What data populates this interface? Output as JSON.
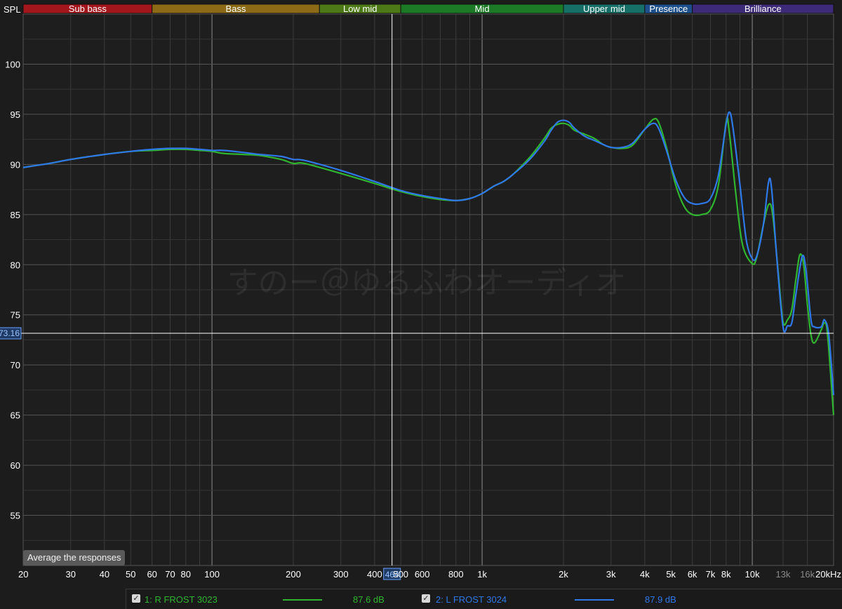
{
  "y_axis_title": "SPL",
  "average_button": {
    "label": "Average the responses"
  },
  "cursor": {
    "x_readout": "464",
    "y_readout": "73.16"
  },
  "watermark": "すのー＠ゆるふわオーディオ",
  "bands": [
    {
      "label": "Sub bass",
      "from": 20,
      "to": 60,
      "color": "#a3161c"
    },
    {
      "label": "Bass",
      "from": 60,
      "to": 250,
      "color": "#8c6a16"
    },
    {
      "label": "Low mid",
      "from": 250,
      "to": 500,
      "color": "#4d7a16"
    },
    {
      "label": "Mid",
      "from": 500,
      "to": 2000,
      "color": "#1c7a27"
    },
    {
      "label": "Upper mid",
      "from": 2000,
      "to": 4000,
      "color": "#177068"
    },
    {
      "label": "Presence",
      "from": 4000,
      "to": 6000,
      "color": "#1c4f8c"
    },
    {
      "label": "Brilliance",
      "from": 6000,
      "to": 20000,
      "color": "#3d2a78"
    }
  ],
  "legend": [
    {
      "checkbox": "✓",
      "name": "1: R FROST 3023",
      "value": "87.6 dB",
      "color": "#2fb52f"
    },
    {
      "checkbox": "✓",
      "name": "2: L FROST 3024",
      "value": "87.9 dB",
      "color": "#2f78e8"
    }
  ],
  "chart_data": {
    "type": "line",
    "xlabel": "",
    "ylabel": "SPL",
    "x_scale": "log",
    "xlim": [
      20,
      20000
    ],
    "ylim": [
      50,
      105
    ],
    "grid": true,
    "x_ticks": [
      {
        "value": 20,
        "label": "20"
      },
      {
        "value": 30,
        "label": "30"
      },
      {
        "value": 40,
        "label": "40"
      },
      {
        "value": 50,
        "label": "50"
      },
      {
        "value": 60,
        "label": "60"
      },
      {
        "value": 70,
        "label": "70"
      },
      {
        "value": 80,
        "label": "80"
      },
      {
        "value": 100,
        "label": "100"
      },
      {
        "value": 200,
        "label": "200"
      },
      {
        "value": 300,
        "label": "300"
      },
      {
        "value": 400,
        "label": "400"
      },
      {
        "value": 500,
        "label": "500"
      },
      {
        "value": 600,
        "label": "600"
      },
      {
        "value": 800,
        "label": "800"
      },
      {
        "value": 1000,
        "label": "1k"
      },
      {
        "value": 2000,
        "label": "2k"
      },
      {
        "value": 3000,
        "label": "3k"
      },
      {
        "value": 4000,
        "label": "4k"
      },
      {
        "value": 5000,
        "label": "5k"
      },
      {
        "value": 6000,
        "label": "6k"
      },
      {
        "value": 7000,
        "label": "7k"
      },
      {
        "value": 8000,
        "label": "8k"
      },
      {
        "value": 10000,
        "label": "10k"
      },
      {
        "value": 13000,
        "label": "13k",
        "dim": true
      },
      {
        "value": 16000,
        "label": "16k",
        "dim": true
      },
      {
        "value": 20000,
        "label": "20kHz"
      }
    ],
    "y_ticks": [
      55,
      60,
      65,
      70,
      75,
      80,
      85,
      90,
      95,
      100
    ],
    "series": [
      {
        "name": "1: R FROST 3023",
        "color": "#2fb52f",
        "points": [
          [
            20,
            89.7
          ],
          [
            25,
            90.1
          ],
          [
            30,
            90.5
          ],
          [
            40,
            91.0
          ],
          [
            50,
            91.3
          ],
          [
            60,
            91.4
          ],
          [
            70,
            91.5
          ],
          [
            80,
            91.5
          ],
          [
            90,
            91.4
          ],
          [
            100,
            91.3
          ],
          [
            110,
            91.1
          ],
          [
            130,
            91.0
          ],
          [
            150,
            90.9
          ],
          [
            180,
            90.5
          ],
          [
            200,
            90.1
          ],
          [
            220,
            90.1
          ],
          [
            300,
            89.1
          ],
          [
            400,
            88.1
          ],
          [
            500,
            87.3
          ],
          [
            600,
            86.8
          ],
          [
            700,
            86.5
          ],
          [
            800,
            86.4
          ],
          [
            900,
            86.6
          ],
          [
            1000,
            87.1
          ],
          [
            1100,
            87.8
          ],
          [
            1200,
            88.3
          ],
          [
            1300,
            89.0
          ],
          [
            1500,
            90.7
          ],
          [
            1700,
            92.6
          ],
          [
            1800,
            93.6
          ],
          [
            1900,
            94.0
          ],
          [
            2000,
            94.1
          ],
          [
            2100,
            93.9
          ],
          [
            2200,
            93.4
          ],
          [
            2400,
            93.0
          ],
          [
            2600,
            92.6
          ],
          [
            2800,
            92.0
          ],
          [
            3000,
            91.7
          ],
          [
            3300,
            91.6
          ],
          [
            3600,
            91.9
          ],
          [
            4000,
            93.5
          ],
          [
            4300,
            94.5
          ],
          [
            4500,
            94.2
          ],
          [
            4800,
            91.8
          ],
          [
            5200,
            88.0
          ],
          [
            5600,
            85.8
          ],
          [
            6000,
            85.0
          ],
          [
            6500,
            85.0
          ],
          [
            7000,
            85.5
          ],
          [
            7500,
            88.0
          ],
          [
            8000,
            94.2
          ],
          [
            8200,
            93.5
          ],
          [
            8700,
            87.0
          ],
          [
            9200,
            82.0
          ],
          [
            10000,
            80.1
          ],
          [
            10400,
            80.8
          ],
          [
            11000,
            84.0
          ],
          [
            11500,
            86.0
          ],
          [
            11900,
            85.0
          ],
          [
            12500,
            79.0
          ],
          [
            13000,
            74.3
          ],
          [
            13500,
            74.5
          ],
          [
            14000,
            75.5
          ],
          [
            14500,
            78.5
          ],
          [
            15000,
            81.0
          ],
          [
            15500,
            80.0
          ],
          [
            16000,
            76.0
          ],
          [
            16500,
            73.0
          ],
          [
            17000,
            72.2
          ],
          [
            18000,
            73.5
          ],
          [
            18500,
            74.2
          ],
          [
            19000,
            73.0
          ],
          [
            20000,
            65.0
          ]
        ]
      },
      {
        "name": "2: L FROST 3024",
        "color": "#2f78e8",
        "points": [
          [
            20,
            89.7
          ],
          [
            25,
            90.1
          ],
          [
            30,
            90.5
          ],
          [
            40,
            91.0
          ],
          [
            50,
            91.3
          ],
          [
            60,
            91.5
          ],
          [
            70,
            91.6
          ],
          [
            80,
            91.6
          ],
          [
            90,
            91.5
          ],
          [
            100,
            91.4
          ],
          [
            110,
            91.4
          ],
          [
            130,
            91.2
          ],
          [
            150,
            91.0
          ],
          [
            180,
            90.8
          ],
          [
            200,
            90.5
          ],
          [
            220,
            90.4
          ],
          [
            300,
            89.4
          ],
          [
            400,
            88.3
          ],
          [
            500,
            87.4
          ],
          [
            600,
            86.9
          ],
          [
            700,
            86.6
          ],
          [
            800,
            86.4
          ],
          [
            900,
            86.6
          ],
          [
            1000,
            87.1
          ],
          [
            1100,
            87.8
          ],
          [
            1200,
            88.3
          ],
          [
            1300,
            89.0
          ],
          [
            1500,
            90.5
          ],
          [
            1700,
            92.3
          ],
          [
            1800,
            93.4
          ],
          [
            1900,
            94.2
          ],
          [
            2000,
            94.4
          ],
          [
            2100,
            94.2
          ],
          [
            2200,
            93.6
          ],
          [
            2400,
            92.8
          ],
          [
            2600,
            92.4
          ],
          [
            2800,
            92.0
          ],
          [
            3000,
            91.7
          ],
          [
            3300,
            91.7
          ],
          [
            3600,
            92.1
          ],
          [
            4000,
            93.5
          ],
          [
            4300,
            94.1
          ],
          [
            4500,
            93.6
          ],
          [
            4800,
            91.5
          ],
          [
            5200,
            88.5
          ],
          [
            5600,
            86.7
          ],
          [
            6000,
            86.1
          ],
          [
            6500,
            86.1
          ],
          [
            7000,
            86.6
          ],
          [
            7500,
            89.0
          ],
          [
            8000,
            94.0
          ],
          [
            8250,
            95.2
          ],
          [
            8500,
            93.5
          ],
          [
            9000,
            88.0
          ],
          [
            9500,
            82.5
          ],
          [
            10000,
            80.6
          ],
          [
            10400,
            80.9
          ],
          [
            11000,
            84.0
          ],
          [
            11500,
            88.3
          ],
          [
            11800,
            87.5
          ],
          [
            12300,
            81.0
          ],
          [
            13000,
            73.8
          ],
          [
            13500,
            73.9
          ],
          [
            14000,
            74.2
          ],
          [
            14500,
            77.0
          ],
          [
            15300,
            80.8
          ],
          [
            15800,
            79.5
          ],
          [
            16500,
            74.5
          ],
          [
            17000,
            73.8
          ],
          [
            18000,
            73.8
          ],
          [
            18500,
            74.5
          ],
          [
            19200,
            73.0
          ],
          [
            20000,
            67.0
          ]
        ]
      }
    ]
  }
}
